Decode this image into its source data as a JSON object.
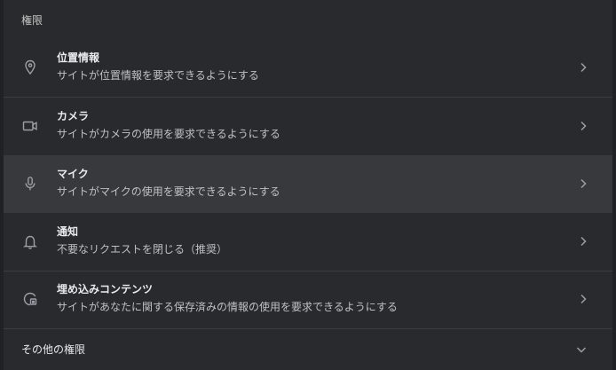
{
  "section": {
    "title": "権限"
  },
  "permissions": [
    {
      "label": "位置情報",
      "description": "サイトが位置情報を要求できるようにする",
      "icon": "location-pin-icon"
    },
    {
      "label": "カメラ",
      "description": "サイトがカメラの使用を要求できるようにする",
      "icon": "camera-icon"
    },
    {
      "label": "マイク",
      "description": "サイトがマイクの使用を要求できるようにする",
      "icon": "microphone-icon"
    },
    {
      "label": "通知",
      "description": "不要なリクエストを閉じる（推奨）",
      "icon": "bell-icon"
    },
    {
      "label": "埋め込みコンテンツ",
      "description": "サイトがあなたに関する保存済みの情報の使用を要求できるようにする",
      "icon": "embedded-content-icon"
    }
  ],
  "more": {
    "label": "その他の権限",
    "icon": "chevron-down-icon"
  },
  "colors": {
    "background": "#202124",
    "card": "#292a2d",
    "hover_row": "#38393c",
    "text_primary": "#e8eaed",
    "text_secondary": "#bdc1c6",
    "icon": "#9aa0a6"
  }
}
